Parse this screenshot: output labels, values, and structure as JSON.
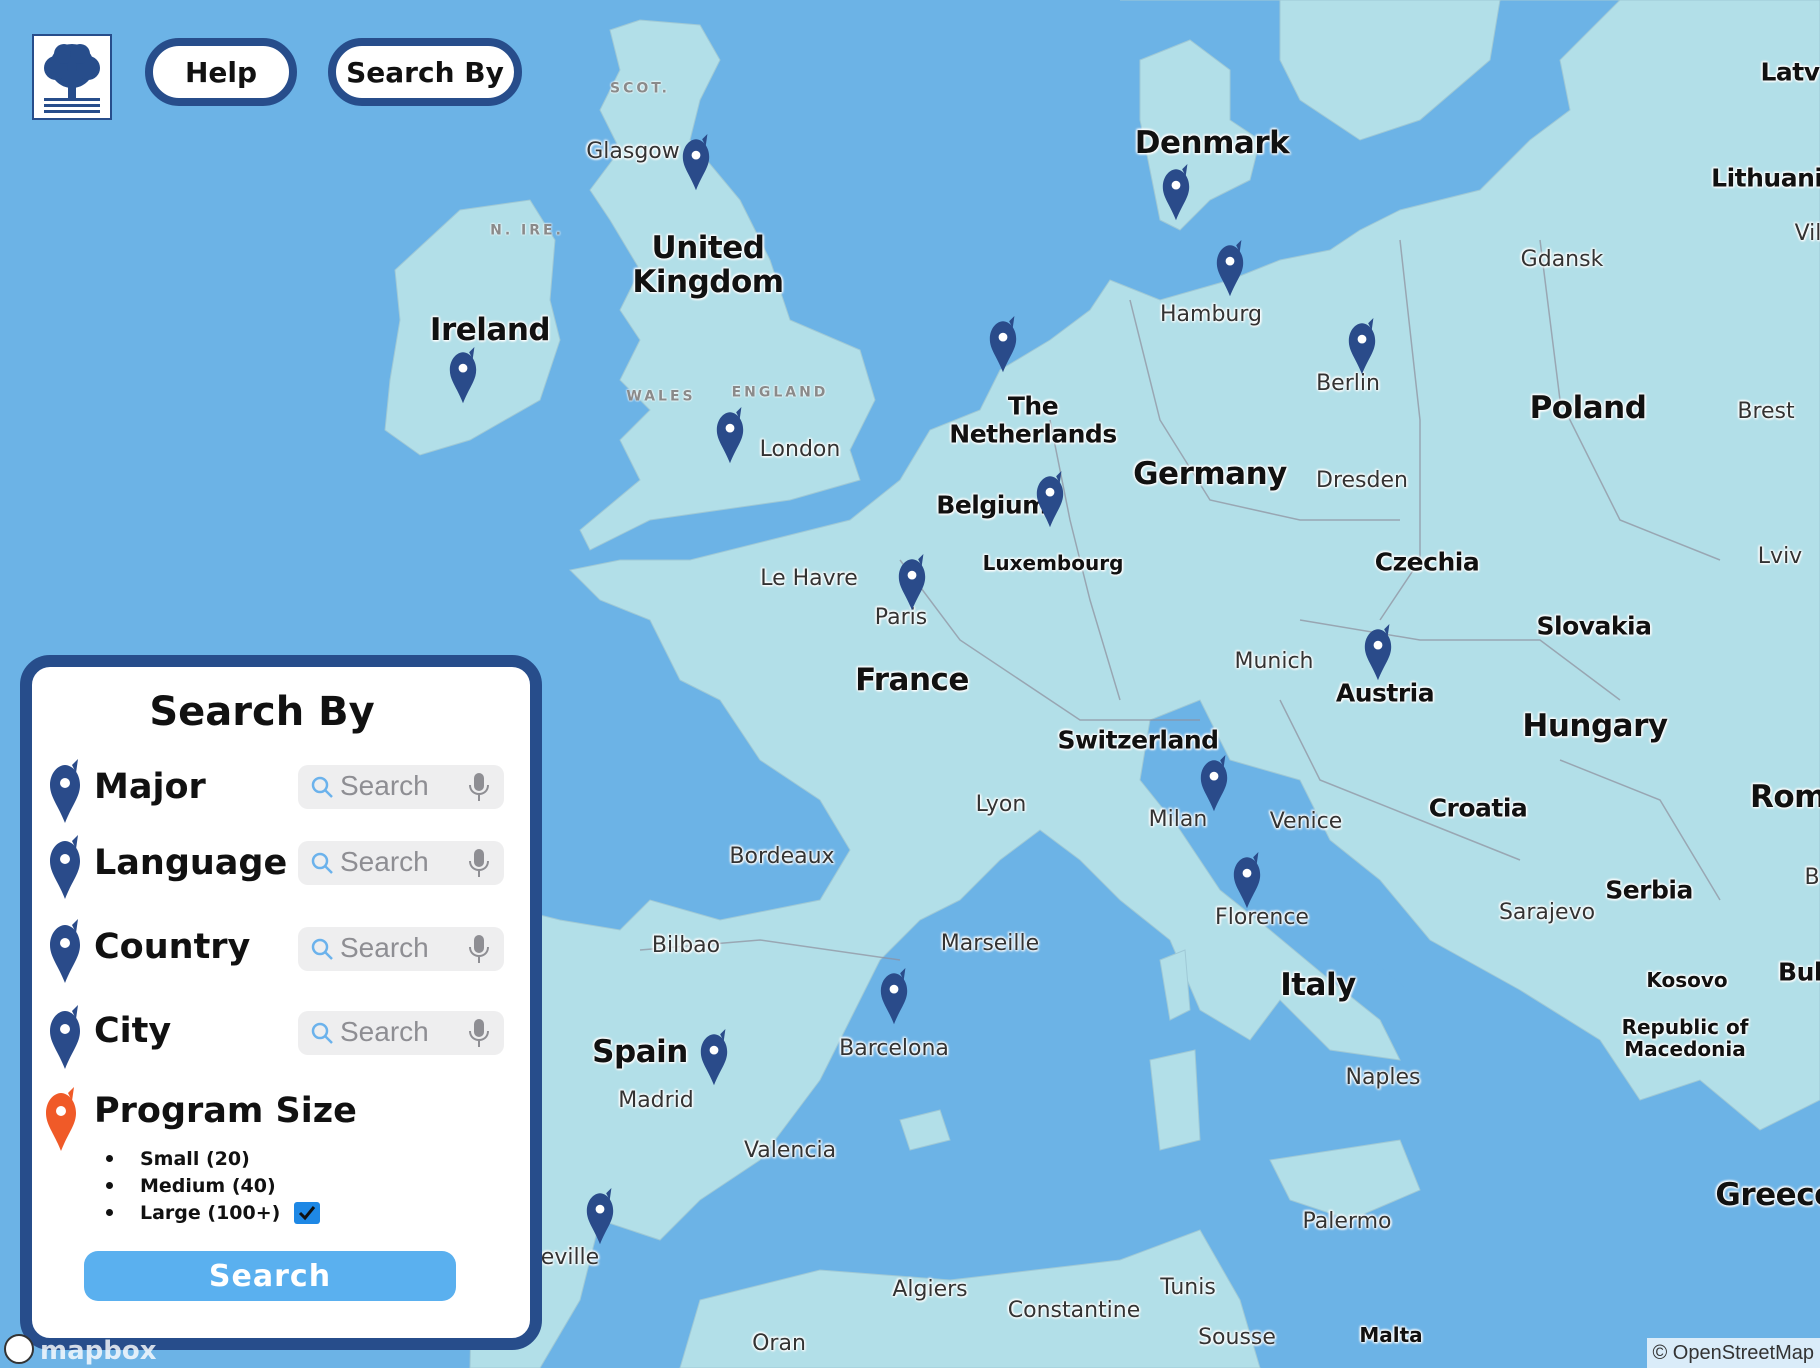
{
  "map": {
    "countries": [
      {
        "name": "Denmark",
        "size": "lg"
      },
      {
        "name": "United\nKingdom",
        "size": "lg"
      },
      {
        "name": "Ireland",
        "size": "lg"
      },
      {
        "name": "Poland",
        "size": "lg"
      },
      {
        "name": "Germany",
        "size": "lg"
      },
      {
        "name": "France",
        "size": "lg"
      },
      {
        "name": "Spain",
        "size": "lg"
      },
      {
        "name": "Italy",
        "size": "lg"
      },
      {
        "name": "Hungary",
        "size": "lg"
      },
      {
        "name": "Czechia",
        "size": "md"
      },
      {
        "name": "Slovakia",
        "size": "md"
      },
      {
        "name": "Austria",
        "size": "md"
      },
      {
        "name": "Switzerland",
        "size": "md"
      },
      {
        "name": "Croatia",
        "size": "md"
      },
      {
        "name": "Serbia",
        "size": "md"
      },
      {
        "name": "Belgium",
        "size": "md"
      },
      {
        "name": "The\nNetherlands",
        "size": "md"
      },
      {
        "name": "Lithuania",
        "size": "md"
      },
      {
        "name": "Greece",
        "size": "lg"
      },
      {
        "name": "Rom",
        "size": "lg"
      },
      {
        "name": "Latv",
        "size": "md"
      },
      {
        "name": "Bul",
        "size": "md"
      }
    ],
    "cities": [
      {
        "name": "Glasgow",
        "bold": false
      },
      {
        "name": "London",
        "bold": false
      },
      {
        "name": "Hamburg",
        "bold": false
      },
      {
        "name": "Berlin",
        "bold": false
      },
      {
        "name": "Gdansk",
        "bold": false
      },
      {
        "name": "Brest",
        "bold": false
      },
      {
        "name": "Dresden",
        "bold": false
      },
      {
        "name": "Lviv",
        "bold": false
      },
      {
        "name": "Luxembourg",
        "bold": true
      },
      {
        "name": "Le Havre",
        "bold": false
      },
      {
        "name": "Paris",
        "bold": false
      },
      {
        "name": "Munich",
        "bold": false
      },
      {
        "name": "Lyon",
        "bold": false
      },
      {
        "name": "Milan",
        "bold": false
      },
      {
        "name": "Venice",
        "bold": false
      },
      {
        "name": "Bordeaux",
        "bold": false
      },
      {
        "name": "Florence",
        "bold": false
      },
      {
        "name": "Sarajevo",
        "bold": false
      },
      {
        "name": "Kosovo",
        "bold": true
      },
      {
        "name": "Republic of\nMacedonia",
        "bold": true
      },
      {
        "name": "Bilbao",
        "bold": false
      },
      {
        "name": "Marseille",
        "bold": false
      },
      {
        "name": "Barcelona",
        "bold": false
      },
      {
        "name": "Madrid",
        "bold": false
      },
      {
        "name": "Naples",
        "bold": false
      },
      {
        "name": "Valencia",
        "bold": false
      },
      {
        "name": "Palermo",
        "bold": false
      },
      {
        "name": "eville",
        "bold": false
      },
      {
        "name": "Algiers",
        "bold": false
      },
      {
        "name": "Tunis",
        "bold": false
      },
      {
        "name": "Constantine",
        "bold": false
      },
      {
        "name": "Oran",
        "bold": false
      },
      {
        "name": "Sousse",
        "bold": false
      },
      {
        "name": "Malta",
        "bold": true
      },
      {
        "name": "Vil",
        "bold": false
      },
      {
        "name": "B",
        "bold": false
      }
    ],
    "regions": [
      "SCOT.",
      "N. IRE.",
      "WALES",
      "ENGLAND"
    ],
    "pins": [
      "Glasgow",
      "Ireland",
      "London",
      "Denmark",
      "Hamburg",
      "Berlin",
      "The Netherlands",
      "Belgium",
      "Paris",
      "Austria",
      "Milan",
      "Florence",
      "Barcelona",
      "Madrid",
      "Seville"
    ],
    "attribution": "© OpenStreetMap",
    "provider_logo_text": "mapbox"
  },
  "header": {
    "help_label": "Help",
    "search_by_label": "Search By"
  },
  "panel": {
    "title": "Search By",
    "rows": [
      {
        "label": "Major",
        "placeholder": "Search"
      },
      {
        "label": "Language",
        "placeholder": "Search"
      },
      {
        "label": "Country",
        "placeholder": "Search"
      },
      {
        "label": "City",
        "placeholder": "Search"
      }
    ],
    "program_size": {
      "label": "Program Size",
      "options": [
        {
          "label": "Small (20)",
          "checked": false
        },
        {
          "label": "Medium (40)",
          "checked": false
        },
        {
          "label": "Large (100+)",
          "checked": true
        }
      ]
    },
    "search_button": "Search"
  },
  "colors": {
    "water": "#6cb3e6",
    "land": "#b2dfe8",
    "border": "#274d8b",
    "pin": "#2a4b8a",
    "pin_active": "#f05a28",
    "button": "#5ab0ef"
  }
}
